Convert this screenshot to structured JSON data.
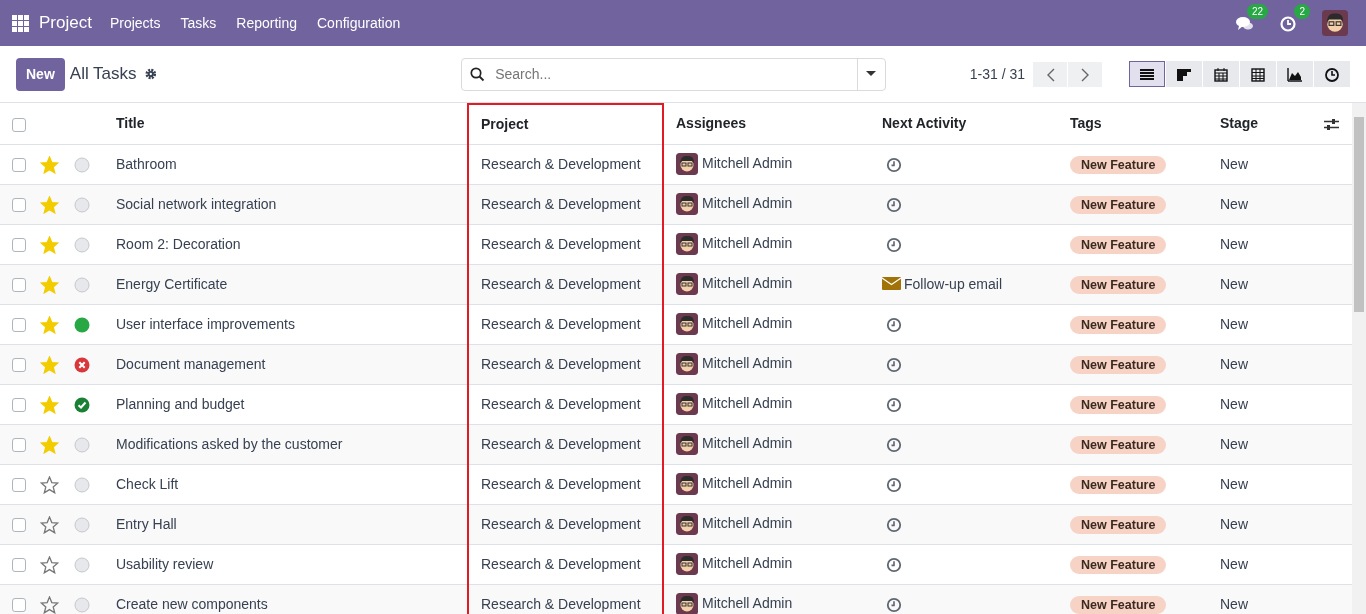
{
  "navbar": {
    "app": "Project",
    "menu": [
      "Projects",
      "Tasks",
      "Reporting",
      "Configuration"
    ],
    "messages_count": "22",
    "activities_count": "2"
  },
  "control_panel": {
    "new_button": "New",
    "title": "All Tasks",
    "search": {
      "placeholder": "Search..."
    },
    "pager": "1-31 / 31",
    "views": [
      {
        "kind": "list",
        "selected": true
      },
      {
        "kind": "kanban",
        "selected": false
      },
      {
        "kind": "calendar",
        "selected": false
      },
      {
        "kind": "pivot",
        "selected": false
      },
      {
        "kind": "graph",
        "selected": false
      },
      {
        "kind": "activity",
        "selected": false
      }
    ]
  },
  "table": {
    "select_all_checked": false,
    "columns": [
      {
        "label": "Title",
        "highlighted": false
      },
      {
        "label": "Project",
        "highlighted": true
      },
      {
        "label": "Assignees",
        "highlighted": false
      },
      {
        "label": "Next Activity",
        "highlighted": false
      },
      {
        "label": "Tags",
        "highlighted": false
      },
      {
        "label": "Stage",
        "highlighted": false
      }
    ],
    "rows": [
      {
        "checked": false,
        "starred": true,
        "status": {
          "kind": "normal"
        },
        "title": "Bathroom",
        "project": "Research & Development",
        "assignee": "Mitchell Admin",
        "activity": {
          "kind": "clock"
        },
        "tag": "New Feature",
        "stage": "New"
      },
      {
        "checked": false,
        "starred": true,
        "status": {
          "kind": "normal"
        },
        "title": "Social network integration",
        "project": "Research & Development",
        "assignee": "Mitchell Admin",
        "activity": {
          "kind": "clock"
        },
        "tag": "New Feature",
        "stage": "New"
      },
      {
        "checked": false,
        "starred": true,
        "status": {
          "kind": "normal"
        },
        "title": "Room 2: Decoration",
        "project": "Research & Development",
        "assignee": "Mitchell Admin",
        "activity": {
          "kind": "clock"
        },
        "tag": "New Feature",
        "stage": "New"
      },
      {
        "checked": false,
        "starred": true,
        "status": {
          "kind": "normal"
        },
        "title": "Energy Certificate",
        "project": "Research & Development",
        "assignee": "Mitchell Admin",
        "activity": {
          "kind": "email",
          "label": "Follow-up email"
        },
        "tag": "New Feature",
        "stage": "New"
      },
      {
        "checked": false,
        "starred": true,
        "status": {
          "kind": "ready"
        },
        "title": "User interface improvements",
        "project": "Research & Development",
        "assignee": "Mitchell Admin",
        "activity": {
          "kind": "clock"
        },
        "tag": "New Feature",
        "stage": "New"
      },
      {
        "checked": false,
        "starred": true,
        "status": {
          "kind": "blocked"
        },
        "title": "Document management",
        "project": "Research & Development",
        "assignee": "Mitchell Admin",
        "activity": {
          "kind": "clock"
        },
        "tag": "New Feature",
        "stage": "New"
      },
      {
        "checked": false,
        "starred": true,
        "status": {
          "kind": "approved"
        },
        "title": "Planning and budget",
        "project": "Research & Development",
        "assignee": "Mitchell Admin",
        "activity": {
          "kind": "clock"
        },
        "tag": "New Feature",
        "stage": "New"
      },
      {
        "checked": false,
        "starred": true,
        "status": {
          "kind": "normal"
        },
        "title": "Modifications asked by the customer",
        "project": "Research & Development",
        "assignee": "Mitchell Admin",
        "activity": {
          "kind": "clock"
        },
        "tag": "New Feature",
        "stage": "New"
      },
      {
        "checked": false,
        "starred": false,
        "status": {
          "kind": "normal"
        },
        "title": "Check Lift",
        "project": "Research & Development",
        "assignee": "Mitchell Admin",
        "activity": {
          "kind": "clock"
        },
        "tag": "New Feature",
        "stage": "New"
      },
      {
        "checked": false,
        "starred": false,
        "status": {
          "kind": "normal"
        },
        "title": "Entry Hall",
        "project": "Research & Development",
        "assignee": "Mitchell Admin",
        "activity": {
          "kind": "clock"
        },
        "tag": "New Feature",
        "stage": "New"
      },
      {
        "checked": false,
        "starred": false,
        "status": {
          "kind": "normal"
        },
        "title": "Usability review",
        "project": "Research & Development",
        "assignee": "Mitchell Admin",
        "activity": {
          "kind": "clock"
        },
        "tag": "New Feature",
        "stage": "New"
      },
      {
        "checked": false,
        "starred": false,
        "status": {
          "kind": "normal"
        },
        "title": "Create new components",
        "project": "Research & Development",
        "assignee": "Mitchell Admin",
        "activity": {
          "kind": "clock"
        },
        "tag": "New Feature",
        "stage": "New"
      }
    ]
  }
}
